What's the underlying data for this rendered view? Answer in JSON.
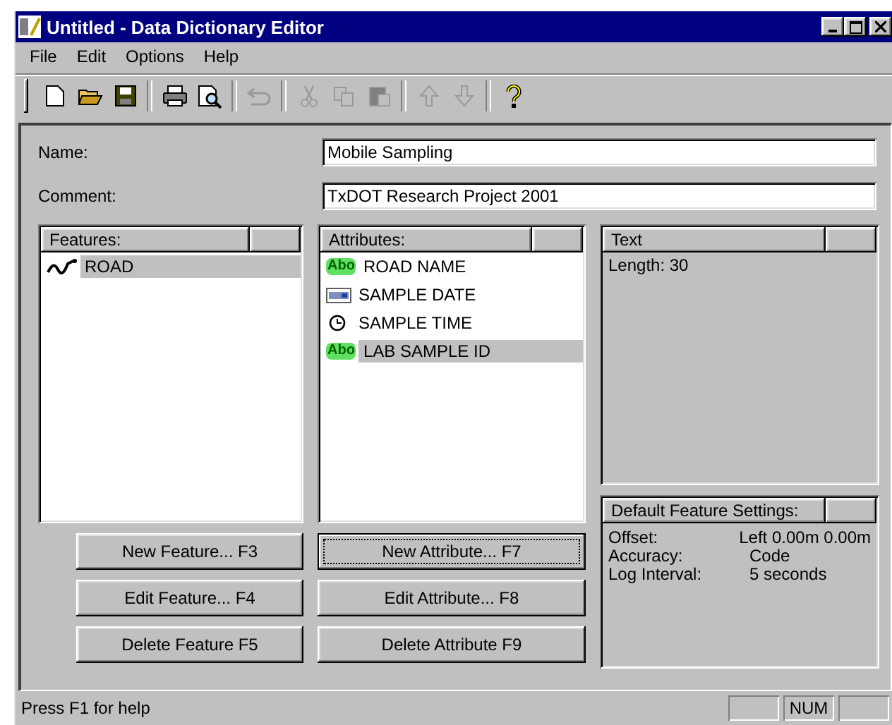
{
  "window": {
    "title": "Untitled - Data Dictionary Editor"
  },
  "menu": [
    {
      "label": "File"
    },
    {
      "label": "Edit"
    },
    {
      "label": "Options"
    },
    {
      "label": "Help"
    }
  ],
  "toolbar": [
    {
      "kind": "new",
      "disabled": false
    },
    {
      "kind": "open",
      "disabled": false
    },
    {
      "kind": "save",
      "disabled": false
    },
    {
      "kind": "separator"
    },
    {
      "kind": "print",
      "disabled": false
    },
    {
      "kind": "preview",
      "disabled": false
    },
    {
      "kind": "separator"
    },
    {
      "kind": "undo",
      "disabled": true
    },
    {
      "kind": "separator"
    },
    {
      "kind": "cut",
      "disabled": true
    },
    {
      "kind": "copy",
      "disabled": true
    },
    {
      "kind": "paste",
      "disabled": true
    },
    {
      "kind": "separator"
    },
    {
      "kind": "up",
      "disabled": true
    },
    {
      "kind": "down",
      "disabled": true
    },
    {
      "kind": "separator"
    },
    {
      "kind": "help",
      "disabled": false
    }
  ],
  "form": [
    {
      "label": "Name:",
      "value": "Mobile Sampling"
    },
    {
      "label": "Comment:",
      "value": "TxDOT Research Project 2001"
    }
  ],
  "features": {
    "header": "Features:",
    "items": [
      {
        "label": "ROAD",
        "kind": "line",
        "selected": true
      }
    ]
  },
  "attributes": {
    "header": "Attributes:",
    "items": [
      {
        "label": "ROAD NAME",
        "kind": "text",
        "icon_text": "Abo",
        "selected": false
      },
      {
        "label": "SAMPLE DATE",
        "kind": "date",
        "selected": false
      },
      {
        "label": "SAMPLE TIME",
        "kind": "time",
        "selected": false
      },
      {
        "label": "LAB SAMPLE ID",
        "kind": "text",
        "icon_text": "Abo",
        "selected": true
      }
    ]
  },
  "text_panel": {
    "header": "Text",
    "lines": [
      "Length: 30"
    ]
  },
  "defaults": {
    "header": "Default Feature Settings:",
    "rows": [
      {
        "label": "Offset:",
        "value": "Left 0.00m 0.00m"
      },
      {
        "label": "Accuracy:",
        "value": "Code"
      },
      {
        "label": "Log Interval:",
        "value": "5 seconds"
      }
    ]
  },
  "feature_buttons": [
    {
      "label": "New Feature... F3",
      "focused": false
    },
    {
      "label": "Edit Feature... F4",
      "focused": false
    },
    {
      "label": "Delete Feature F5",
      "focused": false
    }
  ],
  "attribute_buttons": [
    {
      "label": "New Attribute... F7",
      "focused": true
    },
    {
      "label": "Edit Attribute... F8",
      "focused": false
    },
    {
      "label": "Delete Attribute F9",
      "focused": false
    }
  ],
  "status_bar": {
    "text": "Press F1 for help",
    "panes": [
      {
        "kind": "blank"
      },
      {
        "kind": "text",
        "text": "NUM"
      },
      {
        "kind": "blank"
      }
    ]
  }
}
